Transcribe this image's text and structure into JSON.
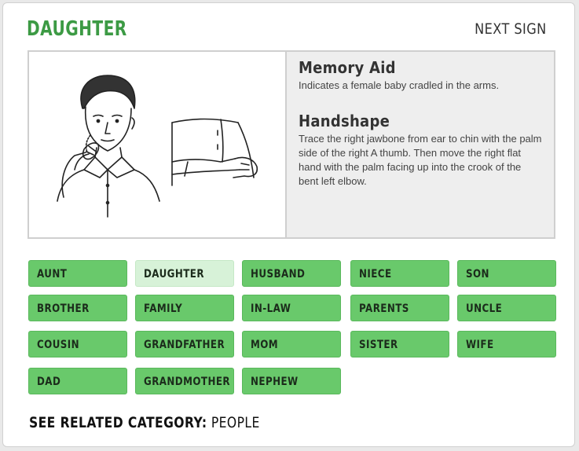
{
  "sign": {
    "title": "DAUGHTER",
    "next_label": "NEXT SIGN"
  },
  "memory_aid": {
    "heading": "Memory Aid",
    "text": "Indicates a female baby cradled in the arms."
  },
  "handshape": {
    "heading": "Handshape",
    "text": "Trace the right jawbone from ear to chin with the palm side of the right A thumb. Then move the right flat hand with the palm facing up into the crook of the bent left elbow."
  },
  "signs": [
    {
      "label": "AUNT",
      "active": false
    },
    {
      "label": "DAUGHTER",
      "active": true
    },
    {
      "label": "HUSBAND",
      "active": false
    },
    {
      "label": "NIECE",
      "active": false
    },
    {
      "label": "SON",
      "active": false
    },
    {
      "label": "BROTHER",
      "active": false
    },
    {
      "label": "FAMILY",
      "active": false
    },
    {
      "label": "IN-LAW",
      "active": false
    },
    {
      "label": "PARENTS",
      "active": false
    },
    {
      "label": "UNCLE",
      "active": false
    },
    {
      "label": "COUSIN",
      "active": false
    },
    {
      "label": "GRANDFATHER",
      "active": false
    },
    {
      "label": "MOM",
      "active": false
    },
    {
      "label": "SISTER",
      "active": false
    },
    {
      "label": "WIFE",
      "active": false
    },
    {
      "label": "DAD",
      "active": false
    },
    {
      "label": "GRANDMOTHER",
      "active": false
    },
    {
      "label": "NEPHEW",
      "active": false
    }
  ],
  "related": {
    "label": "SEE RELATED CATEGORY:",
    "category": "PEOPLE"
  },
  "colors": {
    "title_green": "#3c9a44",
    "button_green": "#69c96b",
    "button_active": "#d7f2d8",
    "info_bg": "#eeeeee"
  }
}
